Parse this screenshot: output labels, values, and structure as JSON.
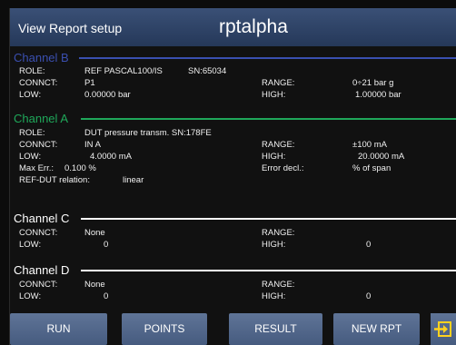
{
  "header": {
    "left_label": "View Report setup",
    "title": "rptalpha"
  },
  "channel_b": {
    "name": "Channel B",
    "color": "#3a4fb0",
    "role_label": "ROLE:",
    "role": "REF PASCAL100/IS",
    "sn": "SN:65034",
    "connect_label": "CONNCT:",
    "connect": "P1",
    "range_label": "RANGE:",
    "range": "0÷21 bar g",
    "low_label": "LOW:",
    "low": "0.00000 bar",
    "high_label": "HIGH:",
    "high": "1.00000 bar"
  },
  "channel_a": {
    "name": "Channel A",
    "color": "#1fa85a",
    "role_label": "ROLE:",
    "role": "DUT pressure transm. SN:178FE",
    "connect_label": "CONNCT:",
    "connect": "IN A",
    "range_label": "RANGE:",
    "range": "±100 mA",
    "low_label": "LOW:",
    "low": "4.0000 mA",
    "high_label": "HIGH:",
    "high": "20.0000 mA",
    "maxerr_label": "Max Err.:",
    "maxerr": "0.100 %",
    "errdecl_label": "Error decl.:",
    "errdecl": "% of span",
    "relation_label": "REF-DUT relation:",
    "relation": "linear"
  },
  "channel_c": {
    "name": "Channel C",
    "color": "#ffffff",
    "connect_label": "CONNCT:",
    "connect": "None",
    "range_label": "RANGE:",
    "low_label": "LOW:",
    "low": "0",
    "high_label": "HIGH:",
    "high": "0"
  },
  "channel_d": {
    "name": "Channel D",
    "color": "#ffffff",
    "connect_label": "CONNCT:",
    "connect": "None",
    "range_label": "RANGE:",
    "low_label": "LOW:",
    "low": "0",
    "high_label": "HIGH:",
    "high": "0"
  },
  "buttons": {
    "run": "RUN",
    "points": "POINTS",
    "result": "RESULT",
    "new_rpt": "NEW RPT",
    "exit_icon": "exit-icon"
  }
}
